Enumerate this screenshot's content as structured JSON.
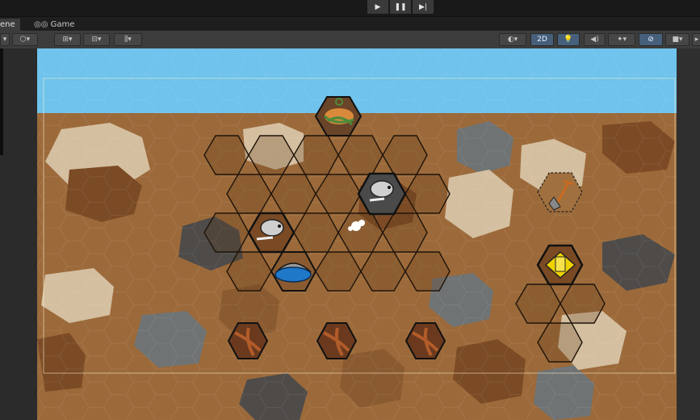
{
  "editor": {
    "play_controls": [
      {
        "name": "play-button",
        "glyph": "▶"
      },
      {
        "name": "pause-button",
        "glyph": "❚❚"
      },
      {
        "name": "step-button",
        "glyph": "▶|"
      }
    ],
    "tabs": [
      {
        "label": "ene",
        "icon": "",
        "active": true
      },
      {
        "label": "Game",
        "icon": "gamepad-icon",
        "active": false
      }
    ],
    "toolbar_right": {
      "view_2d_label": "2D"
    }
  },
  "scene": {
    "sky_color": "#6fc3ec",
    "dirt_color": "#9c6a3a",
    "collectibles": [
      {
        "name": "mole-collectible-1",
        "icon": "mole-icon"
      },
      {
        "name": "mole-collectible-2",
        "icon": "mole-icon"
      },
      {
        "name": "water-pool",
        "icon": "water-icon"
      },
      {
        "name": "roots-sprout",
        "icon": "roots-icon"
      },
      {
        "name": "shovel-tile",
        "icon": "shovel-icon"
      },
      {
        "name": "gold-tile",
        "icon": "gold-icon"
      },
      {
        "name": "dig-cursor",
        "icon": "paw-icon"
      }
    ],
    "root_tiles": [
      {
        "name": "root-tile-1"
      },
      {
        "name": "root-tile-2"
      },
      {
        "name": "root-tile-3"
      }
    ]
  }
}
